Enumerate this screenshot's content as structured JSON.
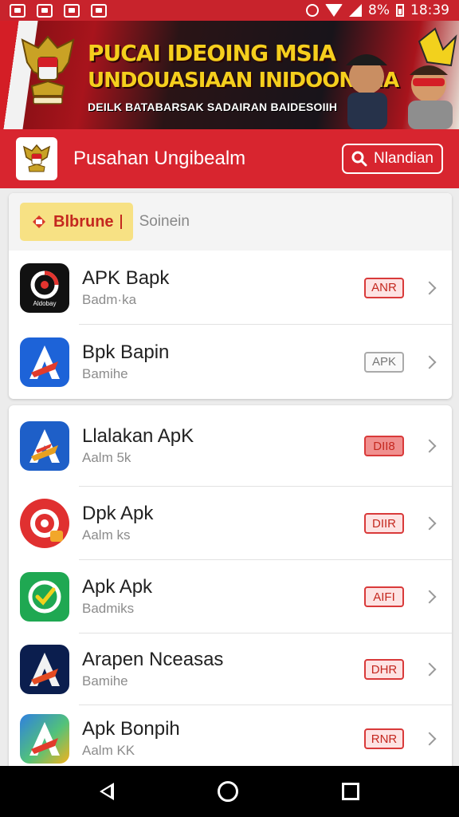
{
  "status_bar": {
    "time": "18:39",
    "battery": "8%",
    "left_icons": [
      "gallery-icon",
      "photo-icon",
      "mail-icon",
      "shield-icon"
    ],
    "right_icons": [
      "alarm-icon",
      "wifi-icon",
      "signal-icon",
      "battery-icon"
    ]
  },
  "banner": {
    "line1": "PUCAI IDEOING MSIA",
    "line2": "UNDOUASIAAN INIDOONSIIA",
    "line3": "DEILK BATABARSAK SADAIRAN BAIDESOIIH",
    "colors": {
      "yellow": "#f5cf1d",
      "red": "#a8141c"
    }
  },
  "header": {
    "title": "Pusahan Ungibealm",
    "search_label": "Nlandian",
    "accent": "#d8252f"
  },
  "filter": {
    "chip_label": "Blbrune",
    "text": "Soinein"
  },
  "apps_top": [
    {
      "name": "APK Bapk",
      "sub": "Badm·ka",
      "badge": "ANR",
      "badge_style": "red",
      "icon": "camera-ring-icon",
      "colors": [
        "#111111",
        "#e3342f"
      ],
      "caption": "Aldobay"
    },
    {
      "name": "Bpk Bapin",
      "sub": "Bamihe",
      "badge": "APK",
      "badge_style": "gray",
      "icon": "arrow-a-icon",
      "colors": [
        "#1d63d8",
        "#e23b2c"
      ]
    }
  ],
  "apps_bottom": [
    {
      "name": "Llalakan ApK",
      "sub": "Aalm 5k",
      "badge": "DII8",
      "badge_style": "solid",
      "icon": "arrow-a-icon",
      "colors": [
        "#1e5fc8",
        "#e8a020"
      ]
    },
    {
      "name": "Dpk Apk",
      "sub": "Aalm ks",
      "badge": "DIIR",
      "badge_style": "red",
      "icon": "target-icon",
      "colors": [
        "#e03030",
        "#f2a72a"
      ]
    },
    {
      "name": "Apk Apk",
      "sub": "Badmiks",
      "badge": "AIFI",
      "badge_style": "red",
      "icon": "check-circle-icon",
      "colors": [
        "#1fa852",
        "#f2d11d"
      ]
    },
    {
      "name": "Arapen Nceasas",
      "sub": "Bamihe",
      "badge": "DHR",
      "badge_style": "red",
      "icon": "arrow-a-icon",
      "colors": [
        "#0b1e4e",
        "#e44b22"
      ]
    },
    {
      "name": "Apk Bonpih",
      "sub": "Aalm KK",
      "badge": "RNR",
      "badge_style": "red",
      "icon": "arrow-a-icon",
      "colors": [
        "#2f7fe0",
        "#f2b21d"
      ]
    }
  ]
}
